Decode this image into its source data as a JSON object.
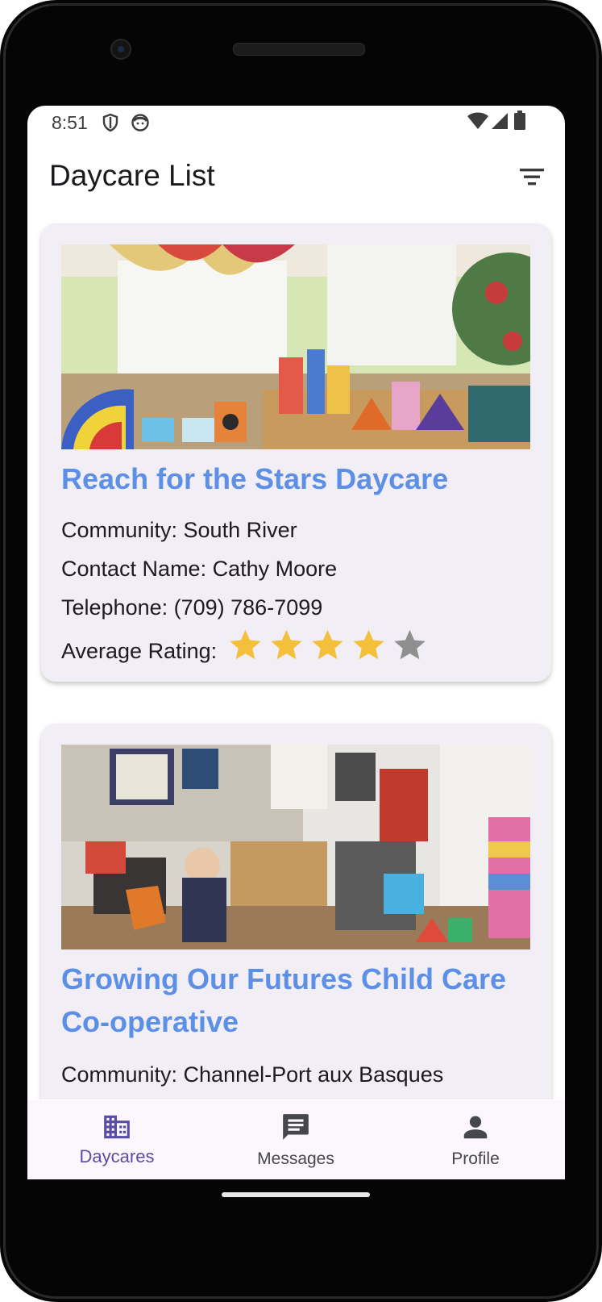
{
  "status_bar": {
    "time": "8:51",
    "left_icons": [
      "shield-icon",
      "face-icon"
    ],
    "right_icons": [
      "wifi-icon",
      "signal-icon",
      "battery-icon"
    ]
  },
  "app_bar": {
    "title": "Daycare List",
    "action_icon": "filter-icon"
  },
  "daycares": [
    {
      "name": "Reach for the Stars Daycare",
      "community_label": "Community: South River",
      "contact_label": "Contact Name: Cathy  Moore",
      "telephone_label": "Telephone: (709) 786-7099",
      "rating_label": "Average Rating:",
      "rating": 4,
      "rating_max": 5,
      "image": "classroom-photo"
    },
    {
      "name": "Growing Our Futures Child Care Co-operative",
      "community_label": "Community: Channel-Port aux Basques",
      "image": "playroom-photo"
    }
  ],
  "bottom_nav": {
    "items": [
      {
        "label": "Daycares",
        "icon": "building-icon",
        "active": true
      },
      {
        "label": "Messages",
        "icon": "message-icon",
        "active": false
      },
      {
        "label": "Profile",
        "icon": "person-icon",
        "active": false
      }
    ]
  },
  "colors": {
    "accent": "#5a4da6",
    "title_blue": "#5c8fe6",
    "card_bg": "#f2eef6",
    "star_filled": "#f4bf3a",
    "star_empty": "#8f8f8f"
  }
}
